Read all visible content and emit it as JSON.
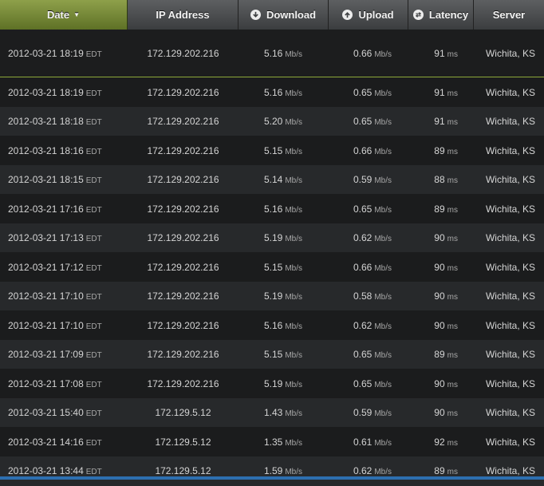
{
  "header": {
    "date": "Date",
    "ip": "IP Address",
    "download": "Download",
    "upload": "Upload",
    "latency": "Latency",
    "server": "Server"
  },
  "units": {
    "speed": "Mb/s",
    "latency": "ms"
  },
  "rows": [
    {
      "date": "2012-03-21 18:19",
      "tz": "EDT",
      "ip": "172.129.202.216",
      "download": "5.16",
      "upload": "0.66",
      "latency": "91",
      "server": "Wichita, KS"
    },
    {
      "date": "2012-03-21 18:19",
      "tz": "EDT",
      "ip": "172.129.202.216",
      "download": "5.16",
      "upload": "0.65",
      "latency": "91",
      "server": "Wichita, KS"
    },
    {
      "date": "2012-03-21 18:18",
      "tz": "EDT",
      "ip": "172.129.202.216",
      "download": "5.20",
      "upload": "0.65",
      "latency": "91",
      "server": "Wichita, KS"
    },
    {
      "date": "2012-03-21 18:16",
      "tz": "EDT",
      "ip": "172.129.202.216",
      "download": "5.15",
      "upload": "0.66",
      "latency": "89",
      "server": "Wichita, KS"
    },
    {
      "date": "2012-03-21 18:15",
      "tz": "EDT",
      "ip": "172.129.202.216",
      "download": "5.14",
      "upload": "0.59",
      "latency": "88",
      "server": "Wichita, KS"
    },
    {
      "date": "2012-03-21 17:16",
      "tz": "EDT",
      "ip": "172.129.202.216",
      "download": "5.16",
      "upload": "0.65",
      "latency": "89",
      "server": "Wichita, KS"
    },
    {
      "date": "2012-03-21 17:13",
      "tz": "EDT",
      "ip": "172.129.202.216",
      "download": "5.19",
      "upload": "0.62",
      "latency": "90",
      "server": "Wichita, KS"
    },
    {
      "date": "2012-03-21 17:12",
      "tz": "EDT",
      "ip": "172.129.202.216",
      "download": "5.15",
      "upload": "0.66",
      "latency": "90",
      "server": "Wichita, KS"
    },
    {
      "date": "2012-03-21 17:10",
      "tz": "EDT",
      "ip": "172.129.202.216",
      "download": "5.19",
      "upload": "0.58",
      "latency": "90",
      "server": "Wichita, KS"
    },
    {
      "date": "2012-03-21 17:10",
      "tz": "EDT",
      "ip": "172.129.202.216",
      "download": "5.16",
      "upload": "0.62",
      "latency": "90",
      "server": "Wichita, KS"
    },
    {
      "date": "2012-03-21 17:09",
      "tz": "EDT",
      "ip": "172.129.202.216",
      "download": "5.15",
      "upload": "0.65",
      "latency": "89",
      "server": "Wichita, KS"
    },
    {
      "date": "2012-03-21 17:08",
      "tz": "EDT",
      "ip": "172.129.202.216",
      "download": "5.19",
      "upload": "0.65",
      "latency": "90",
      "server": "Wichita, KS"
    },
    {
      "date": "2012-03-21 15:40",
      "tz": "EDT",
      "ip": "172.129.5.12",
      "download": "1.43",
      "upload": "0.59",
      "latency": "90",
      "server": "Wichita, KS"
    },
    {
      "date": "2012-03-21 14:16",
      "tz": "EDT",
      "ip": "172.129.5.12",
      "download": "1.35",
      "upload": "0.61",
      "latency": "92",
      "server": "Wichita, KS"
    },
    {
      "date": "2012-03-21 13:44",
      "tz": "EDT",
      "ip": "172.129.5.12",
      "download": "1.59",
      "upload": "0.62",
      "latency": "89",
      "server": "Wichita, KS"
    }
  ],
  "colors": {
    "accent": "#8da83a",
    "scrollbar": "#2d6fb0"
  }
}
